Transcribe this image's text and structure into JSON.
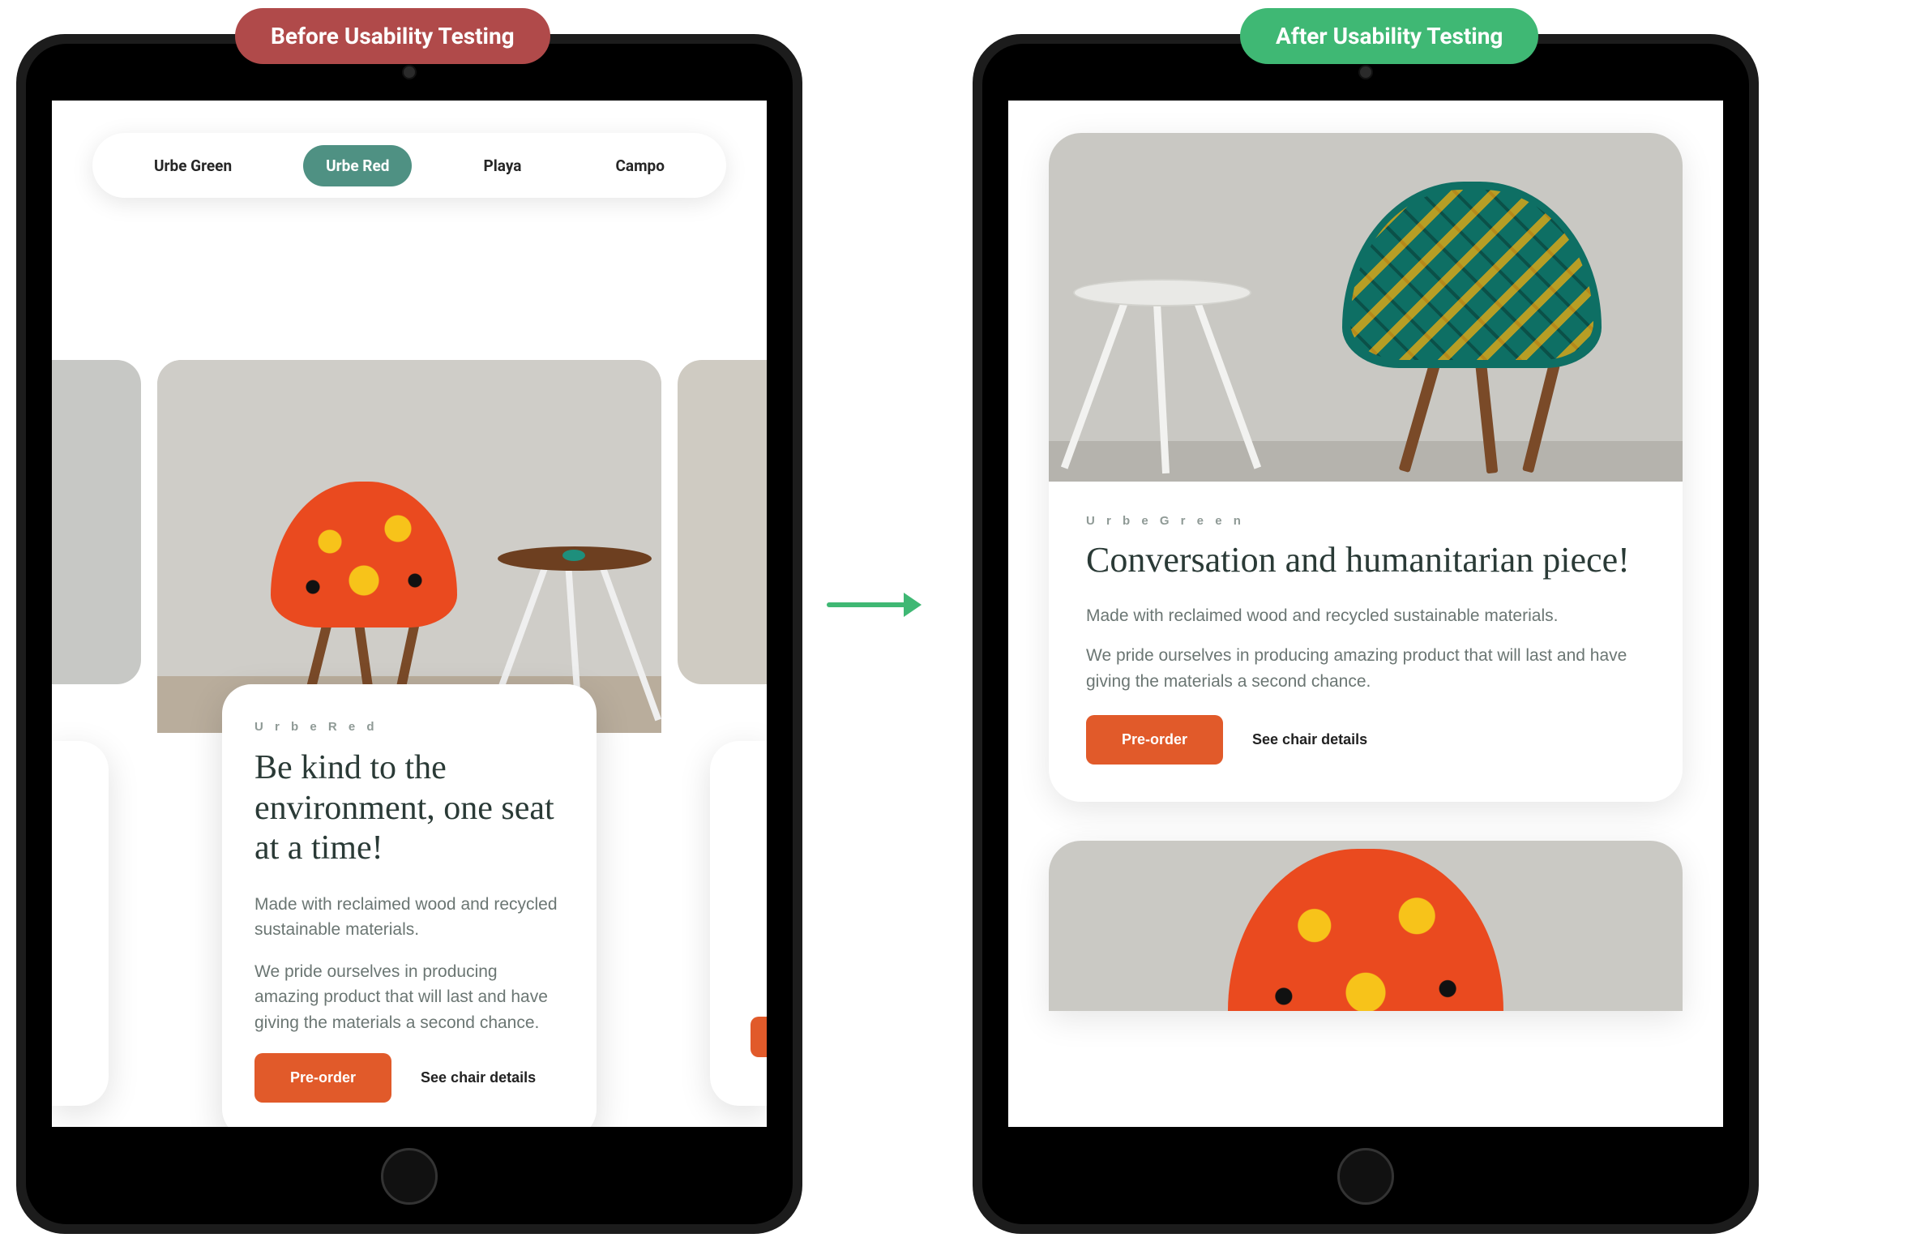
{
  "badges": {
    "before": "Before Usability Testing",
    "after": "After Usability Testing"
  },
  "colors": {
    "badge_before": "#B04A4A",
    "badge_after": "#3FB874",
    "tab_active_bg": "#4F9183",
    "cta_bg": "#e15a2a"
  },
  "left": {
    "tabs": [
      "Urbe Green",
      "Urbe Red",
      "Playa",
      "Campo"
    ],
    "active_tab_index": 1,
    "card": {
      "eyebrow": "U r b e  R e d",
      "title": "Be kind to the environment, one seat at a time!",
      "body1": "Made with reclaimed wood and recycled sustainable materials.",
      "body2": "We pride ourselves in producing amazing product that will last and have giving the materials a second chance.",
      "cta_primary": "Pre-order",
      "cta_secondary": "See chair details"
    }
  },
  "right": {
    "card": {
      "eyebrow": "U r b e  G r e e n",
      "title": "Conversation and humanitarian piece!",
      "body1": "Made with reclaimed wood and recycled sustainable materials.",
      "body2": "We pride ourselves in producing amazing product that will last and have giving the materials a second chance.",
      "cta_primary": "Pre-order",
      "cta_secondary": "See chair details"
    }
  }
}
